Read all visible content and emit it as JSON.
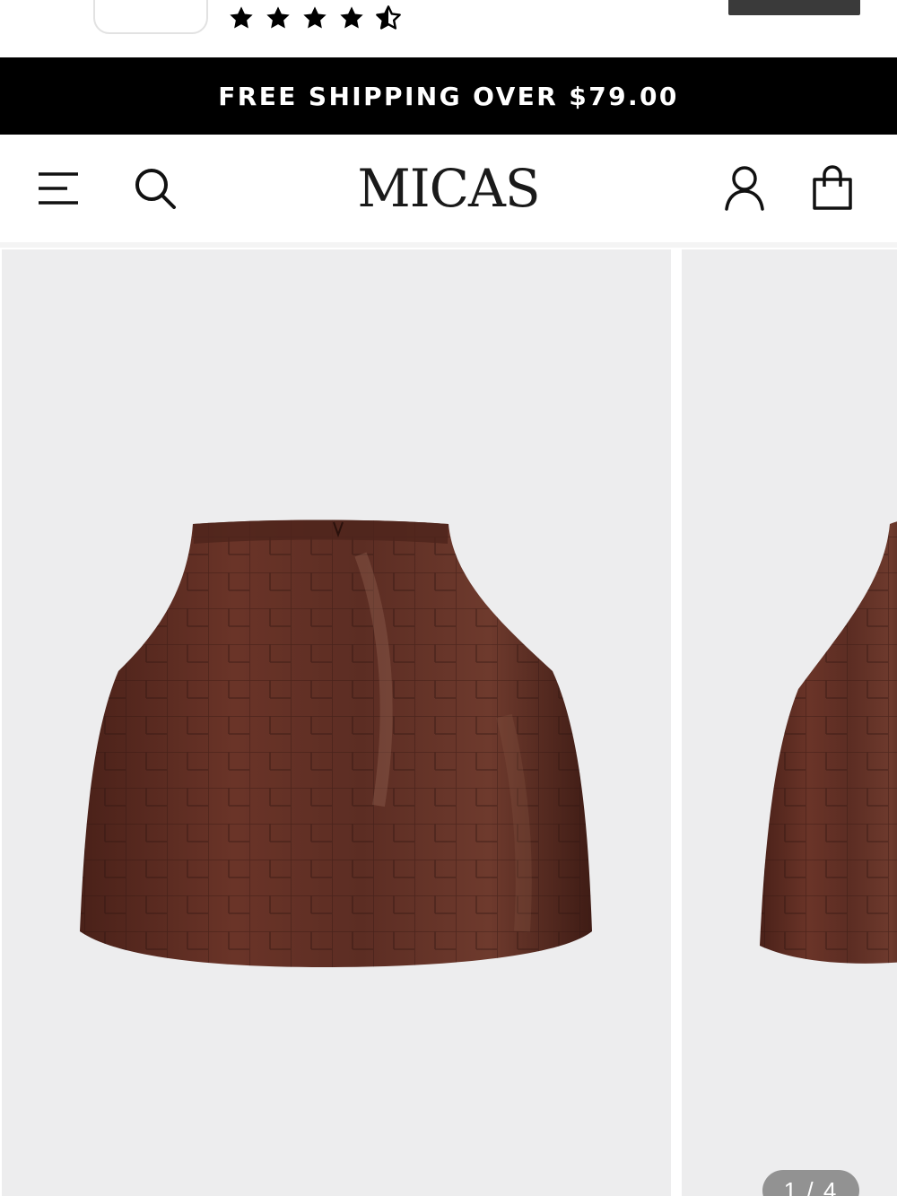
{
  "app_banner": {
    "rating_icons": [
      "star-icon",
      "star-icon",
      "star-icon",
      "star-icon",
      "star-half-icon"
    ]
  },
  "announcement": {
    "text": "FREE SHIPPING OVER $79.00"
  },
  "header": {
    "logo_text": "MICAS",
    "icons": {
      "menu": "hamburger-menu-icon",
      "search": "search-icon",
      "account": "user-account-icon",
      "cart": "shopping-bag-icon"
    }
  },
  "gallery": {
    "counter": "1 / 4",
    "background_color": "#ededee",
    "product_color": "#5a2e24"
  }
}
